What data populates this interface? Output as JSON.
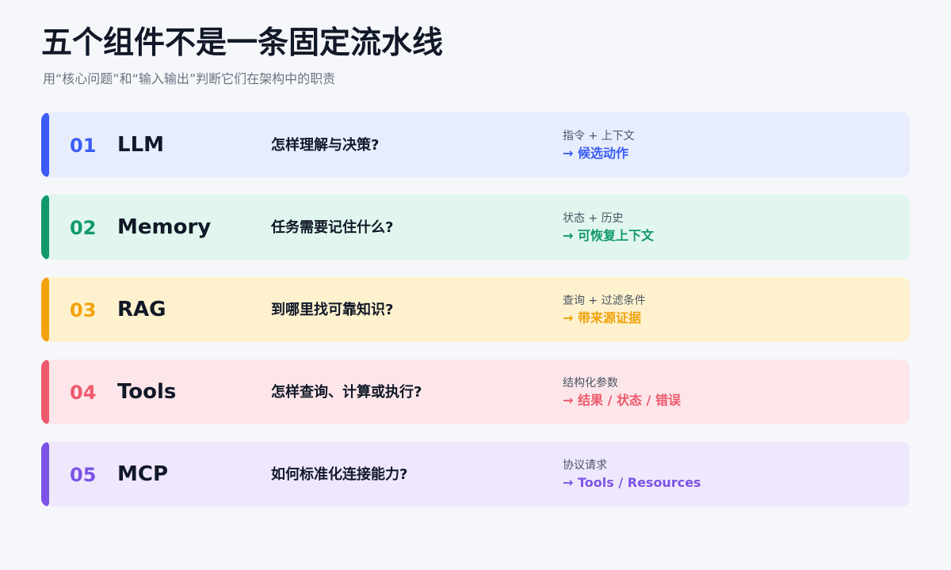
{
  "header": {
    "title": "五个组件不是一条固定流水线",
    "subtitle": "用“核心问题”和“输入输出”判断它们在架构中的职责"
  },
  "components": [
    {
      "number": "01",
      "name": "LLM",
      "question": "怎样理解与决策?",
      "input": "指令 + 上下文",
      "output": "→ 候选动作",
      "accent": "#3b5cf6",
      "background": "#e7edfd"
    },
    {
      "number": "02",
      "name": "Memory",
      "question": "任务需要记住什么?",
      "input": "状态 + 历史",
      "output": "→ 可恢复上下文",
      "accent": "#12996b",
      "background": "#e0f6ee"
    },
    {
      "number": "03",
      "name": "RAG",
      "question": "到哪里找可靠知识?",
      "input": "查询 + 过滤条件",
      "output": "→ 带来源证据",
      "accent": "#f2a20c",
      "background": "#fef2ce"
    },
    {
      "number": "04",
      "name": "Tools",
      "question": "怎样查询、计算或执行?",
      "input": "结构化参数",
      "output": "→ 结果 / 状态 / 错误",
      "accent": "#ee5a6c",
      "background": "#fde6ea"
    },
    {
      "number": "05",
      "name": "MCP",
      "question": "如何标准化连接能力?",
      "input": "协议请求",
      "output": "→ Tools / Resources",
      "accent": "#7c53e6",
      "background": "#efe8fd"
    }
  ]
}
